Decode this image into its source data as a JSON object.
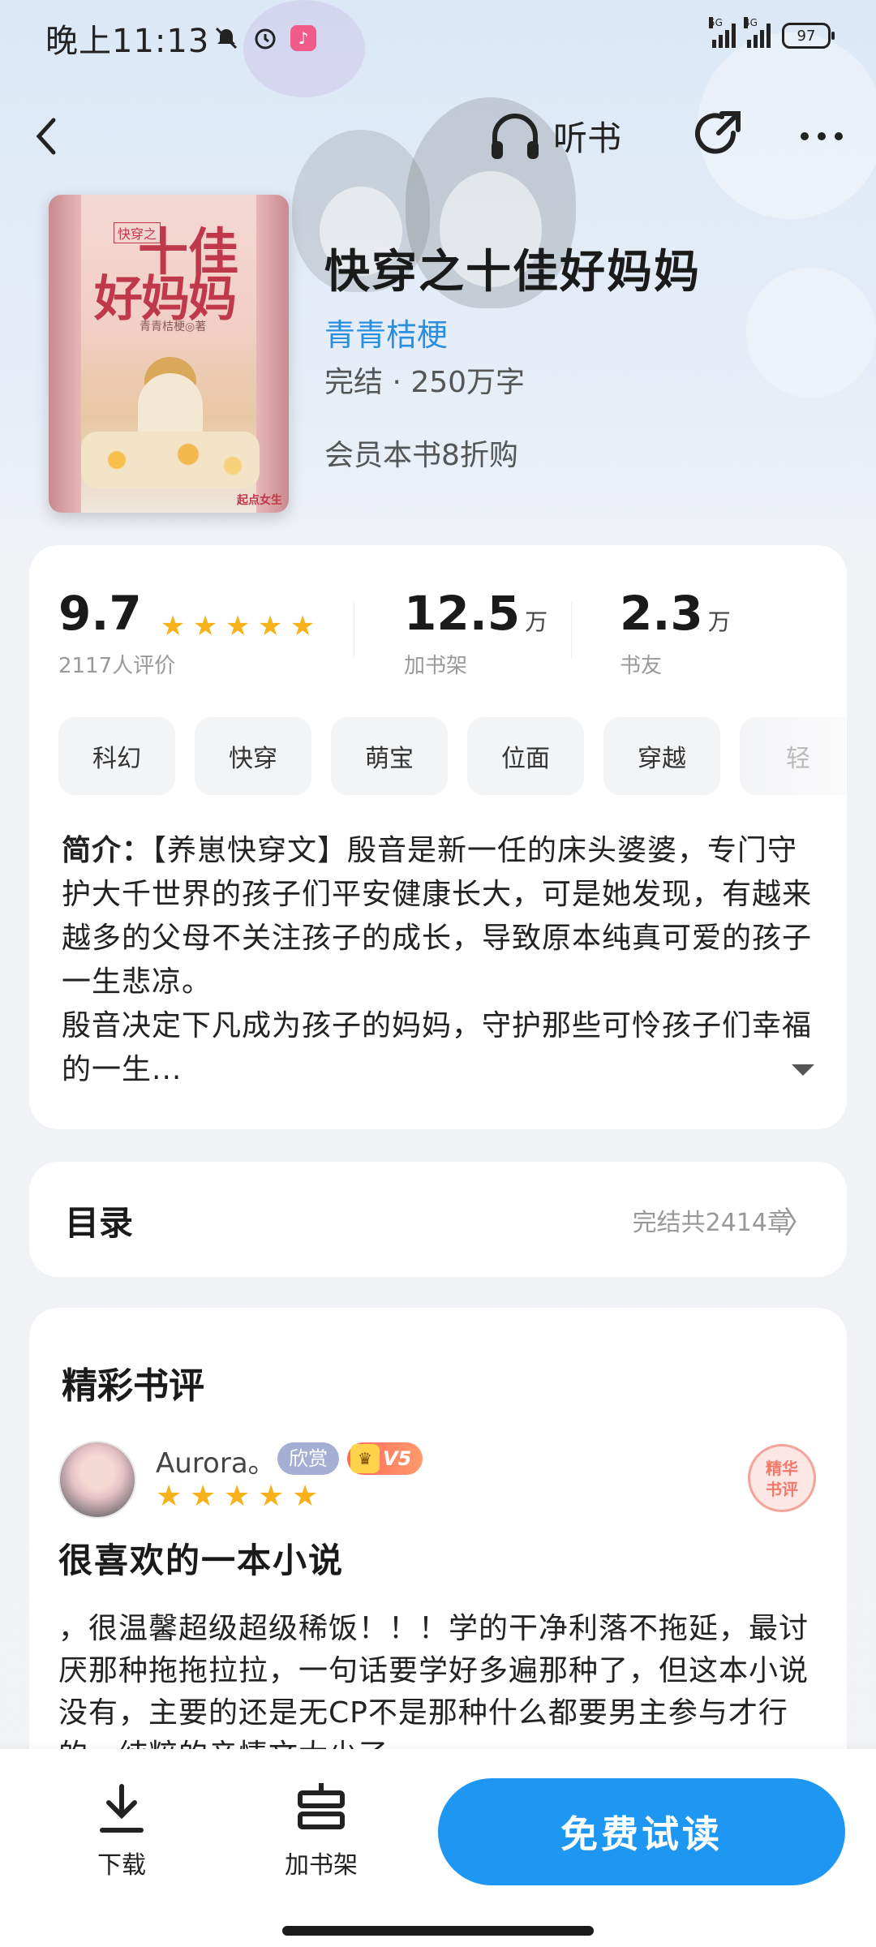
{
  "status_bar": {
    "time": "晚上11:13",
    "signal_1_tag": "5G",
    "signal_2_tag": "4G",
    "battery": "97"
  },
  "nav": {
    "listen_label": "听书"
  },
  "book": {
    "title": "快穿之十佳好妈妈",
    "author": "青青桔梗",
    "meta": "完结 · 250万字",
    "promo": "会员本书8折购",
    "cover": {
      "tag": "快穿之",
      "title_line1": "十佳",
      "title_line2": "好妈妈",
      "author": "青青桔梗◎著",
      "publisher": "起点女生"
    }
  },
  "stats": {
    "rating": "9.7",
    "rating_label": "2117人评价",
    "rating_stars": 5,
    "shelf_value": "12.5",
    "shelf_unit": "万",
    "shelf_label": "加书架",
    "fans_value": "2.3",
    "fans_unit": "万",
    "fans_label": "书友"
  },
  "tags": [
    "科幻",
    "快穿",
    "萌宝",
    "位面",
    "穿越",
    "轻"
  ],
  "intro": {
    "label": "简介：",
    "text": "【养崽快穿文】殷音是新一任的床头婆婆，专门守护大千世界的孩子们平安健康长大，可是她发现，有越来越多的父母不关注孩子的成长，导致原本纯真可爱的孩子一生悲凉。\n殷音决定下凡成为孩子的妈妈，守护那些可怜孩子们幸福的一生..."
  },
  "toc": {
    "title": "目录",
    "meta": "完结共2414章",
    "chevron": "〉"
  },
  "reviews": {
    "title": "精彩书评",
    "items": [
      {
        "name": "Aurora。",
        "badge": "欣赏",
        "level": "V5",
        "stars": 5,
        "seal_line1": "精华",
        "seal_line2": "书评",
        "headline": "很喜欢的一本小说",
        "body": "，很温馨超级超级稀饭！！！学的干净利落不拖延，最讨厌那种拖拖拉拉，一句话要学好多遍那种了，但这本小说没有，主要的还是无CP不是那种什么都要男主参与才行的，纯粹的亲情文太少了"
      }
    ]
  },
  "bottom_bar": {
    "download_label": "下载",
    "shelf_label": "加书架",
    "read_label": "免费试读"
  },
  "colors": {
    "accent": "#1e97f3",
    "author_link": "#2b8fe0",
    "star": "#f7b21b"
  }
}
